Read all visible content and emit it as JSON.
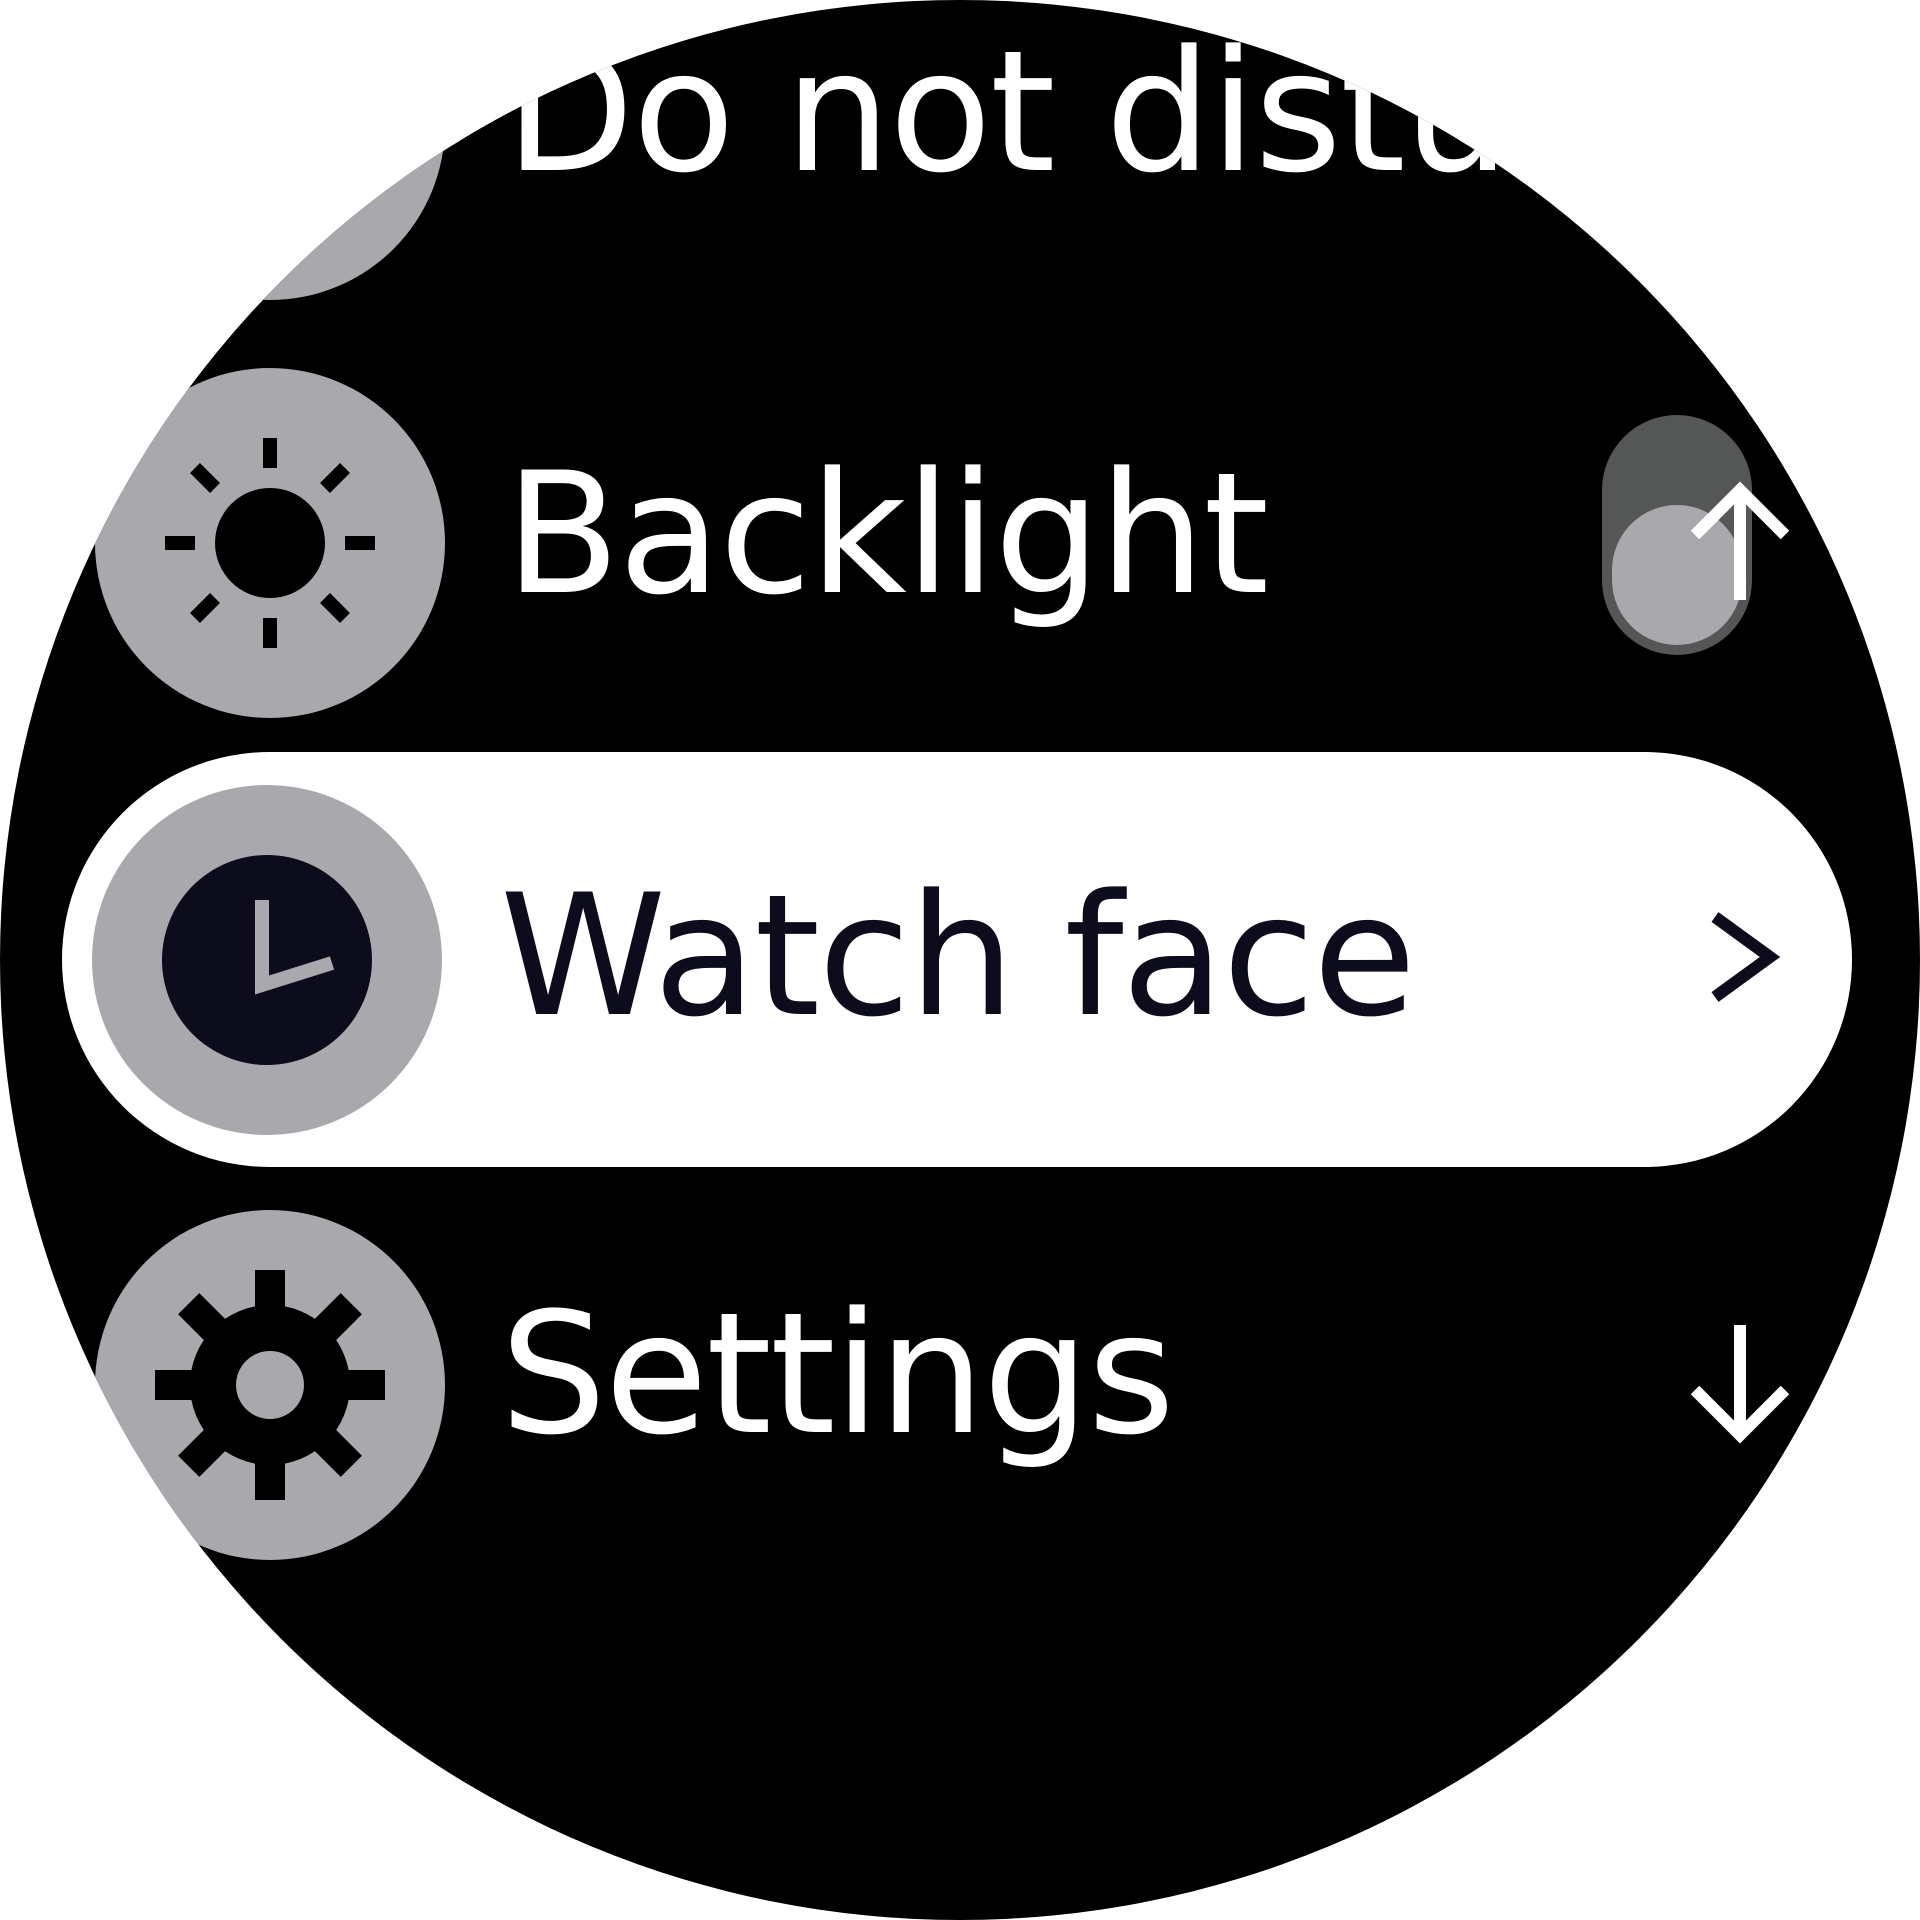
{
  "menu": {
    "items": [
      {
        "label": "Do not disturb",
        "icon": "do-not-disturb-icon"
      },
      {
        "label": "Backlight",
        "icon": "sun-icon"
      },
      {
        "label": "Watch face",
        "icon": "clock-icon",
        "selected": true,
        "chevron": ">"
      },
      {
        "label": "Settings",
        "icon": "gear-icon"
      }
    ]
  },
  "scroll": {
    "up_icon": "arrow-up-icon",
    "down_icon": "arrow-down-icon"
  },
  "colors": {
    "background": "#000000",
    "icon_circle": "#a9a8ad",
    "selected_background": "#ffffff",
    "selected_text": "#0d0c1d",
    "scroll_track": "#555756"
  }
}
